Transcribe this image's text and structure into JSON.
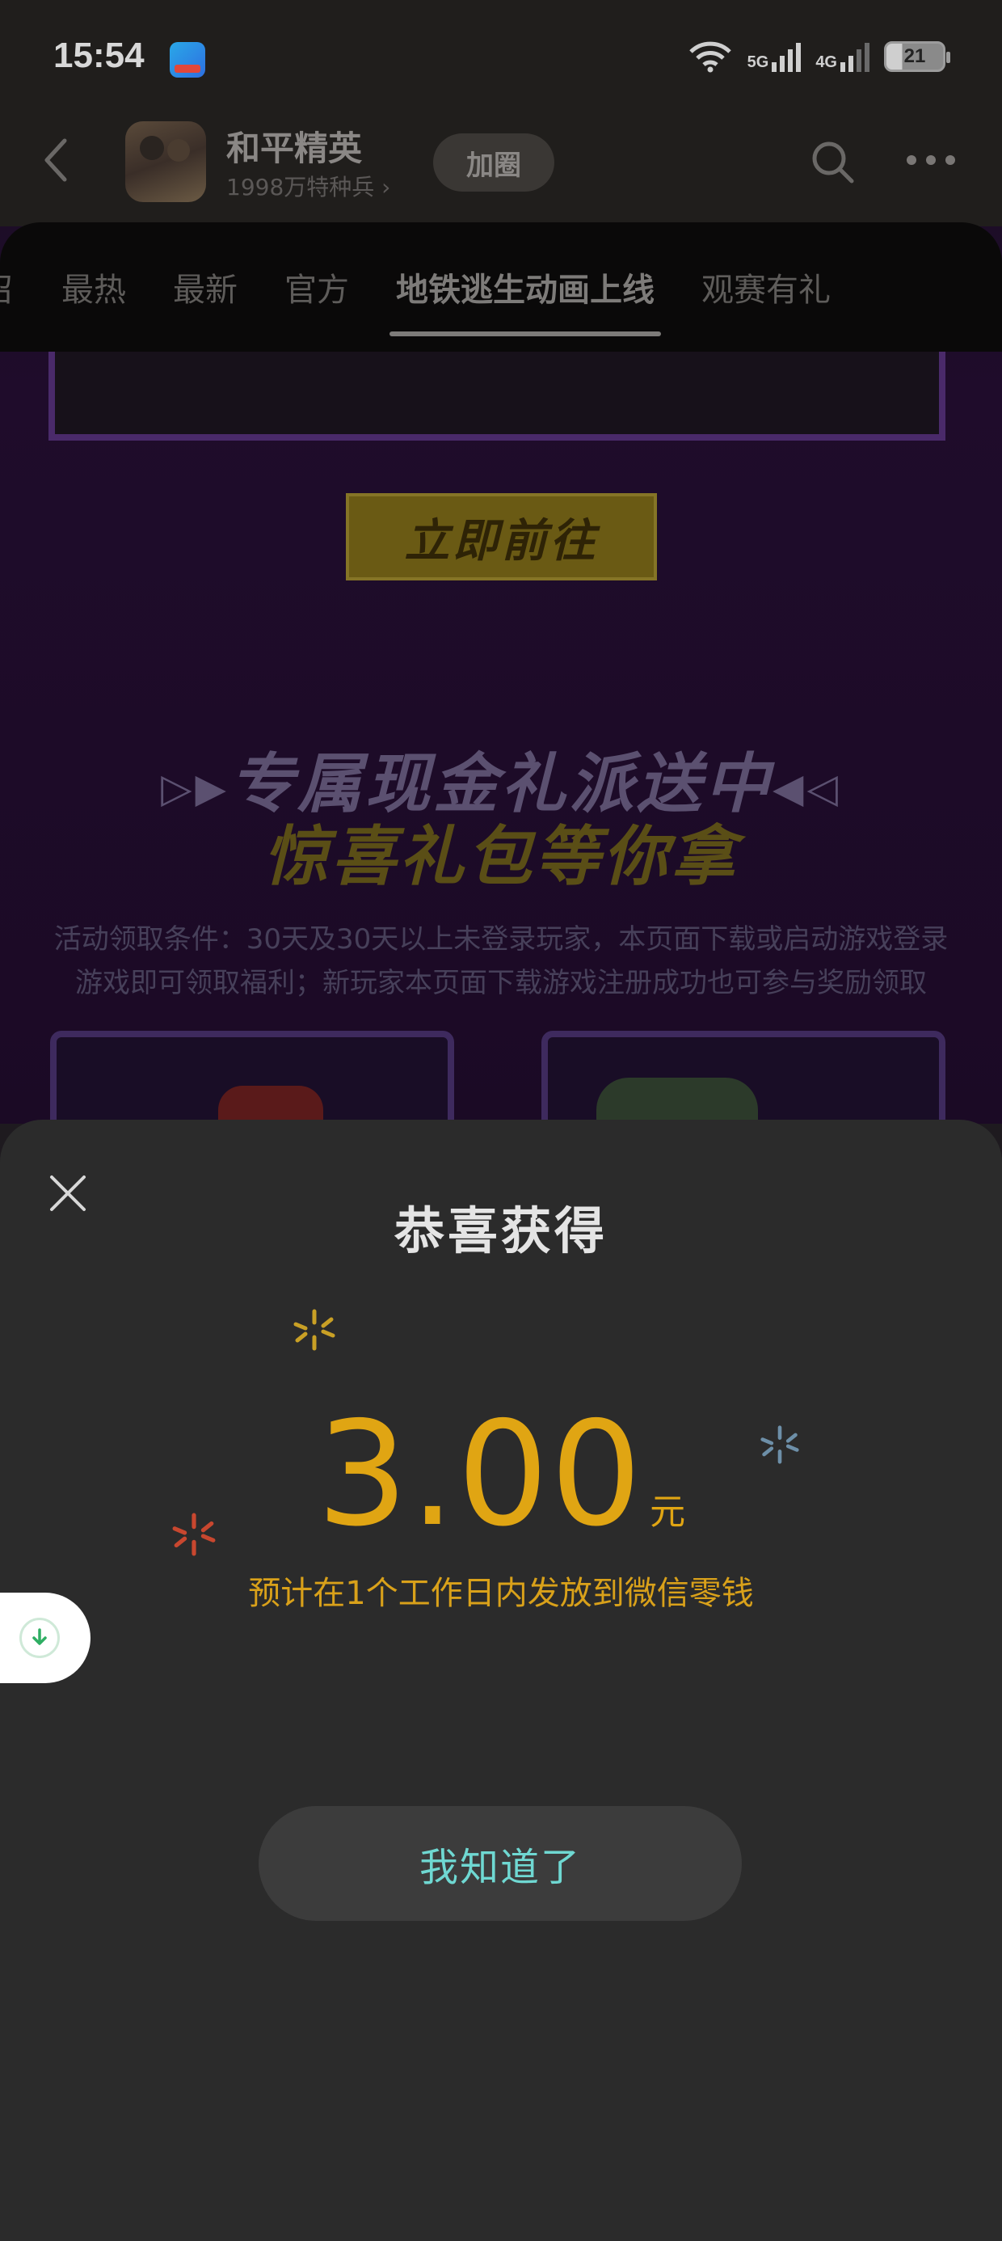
{
  "status_bar": {
    "time": "15:54",
    "network_1": "5G",
    "network_2": "4G",
    "battery": "21"
  },
  "header": {
    "title": "和平精英",
    "subtitle": "1998万特种兵 ›",
    "join_label": "加圈",
    "icons": [
      "back-icon",
      "search-icon",
      "more-icon"
    ]
  },
  "tabs": {
    "items": [
      {
        "label": "召"
      },
      {
        "label": "最热"
      },
      {
        "label": "最新"
      },
      {
        "label": "官方"
      },
      {
        "label": "地铁逃生动画上线"
      },
      {
        "label": "观赛有礼"
      }
    ],
    "active_index": 4
  },
  "background_page": {
    "go_button": "立即前往",
    "promo_line_1": "专属现金礼派送中",
    "promo_line_2": "惊喜礼包等你拿",
    "condition_line_1": "活动领取条件：30天及30天以上未登录玩家，本页面下载或启动游戏登录",
    "condition_line_2": "游戏即可领取福利；新玩家本页面下载游戏注册成功也可参与奖励领取"
  },
  "reward_sheet": {
    "title": "恭喜获得",
    "amount": "3.00",
    "unit": "元",
    "notice": "预计在1个工作日内发放到微信零钱",
    "confirm_label": "我知道了"
  },
  "colors": {
    "amount": "#e0a513",
    "confirm_text": "#6fd8d2",
    "sheet_bg": "#2b2b2b",
    "sparkle_yellow": "#c9a025",
    "sparkle_blue": "#6d8fa8",
    "sparkle_red": "#c8472f"
  }
}
